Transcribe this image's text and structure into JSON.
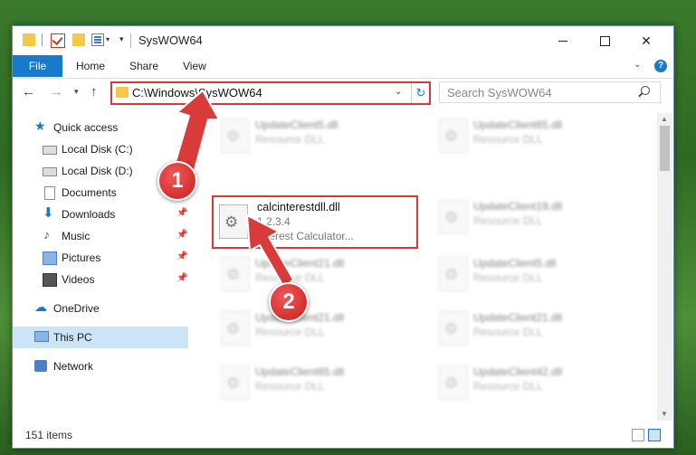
{
  "window": {
    "title": "SysWOW64",
    "buttons": {
      "minimize": "—",
      "maximize": "☐",
      "close": "✕"
    }
  },
  "ribbon": {
    "tabs": [
      {
        "label": "File"
      },
      {
        "label": "Home"
      },
      {
        "label": "Share"
      },
      {
        "label": "View"
      }
    ],
    "help": "?"
  },
  "address": {
    "path": "C:\\Windows\\SysWOW64",
    "search_placeholder": "Search SysWOW64"
  },
  "sidebar": {
    "items": [
      {
        "label": "Quick access",
        "icon": "star-icon"
      },
      {
        "label": "Local Disk (C:)",
        "icon": "drive-icon"
      },
      {
        "label": "Local Disk (D:)",
        "icon": "drive-icon"
      },
      {
        "label": "Documents",
        "icon": "document-icon"
      },
      {
        "label": "Downloads",
        "icon": "download-icon"
      },
      {
        "label": "Music",
        "icon": "music-icon"
      },
      {
        "label": "Pictures",
        "icon": "pictures-icon"
      },
      {
        "label": "Videos",
        "icon": "video-icon"
      },
      {
        "label": "OneDrive",
        "icon": "cloud-icon"
      },
      {
        "label": "This PC",
        "icon": "computer-icon"
      },
      {
        "label": "Network",
        "icon": "network-icon"
      }
    ]
  },
  "files": {
    "left": [
      {
        "name": "UpdateClient5.dll",
        "type": "Resource DLL"
      },
      {
        "name": "UpdateClient21.dll",
        "type": "Resource DLL"
      },
      {
        "name": "UpdateClient21.dll",
        "type": "Resource DLL"
      },
      {
        "name": "UpdateClient65.dll",
        "type": "Resource DLL"
      }
    ],
    "right": [
      {
        "name": "UpdateClient65.dll",
        "type": "Resource DLL"
      },
      {
        "name": "UpdateClient19.dll",
        "type": "Resource DLL"
      },
      {
        "name": "UpdateClient5.dll",
        "type": "Resource DLL"
      },
      {
        "name": "UpdateClient21.dll",
        "type": "Resource DLL"
      },
      {
        "name": "UpdateClient42.dll",
        "type": "Resource DLL"
      }
    ],
    "highlighted": {
      "name": "calcinterestdll.dll",
      "version": "1.2.3.4",
      "description": "Interest Calculator..."
    }
  },
  "status": {
    "items": "151 items"
  },
  "annotations": {
    "step1": "1",
    "step2": "2"
  },
  "colors": {
    "accent": "#1979ca",
    "highlight": "#d33a3a"
  }
}
